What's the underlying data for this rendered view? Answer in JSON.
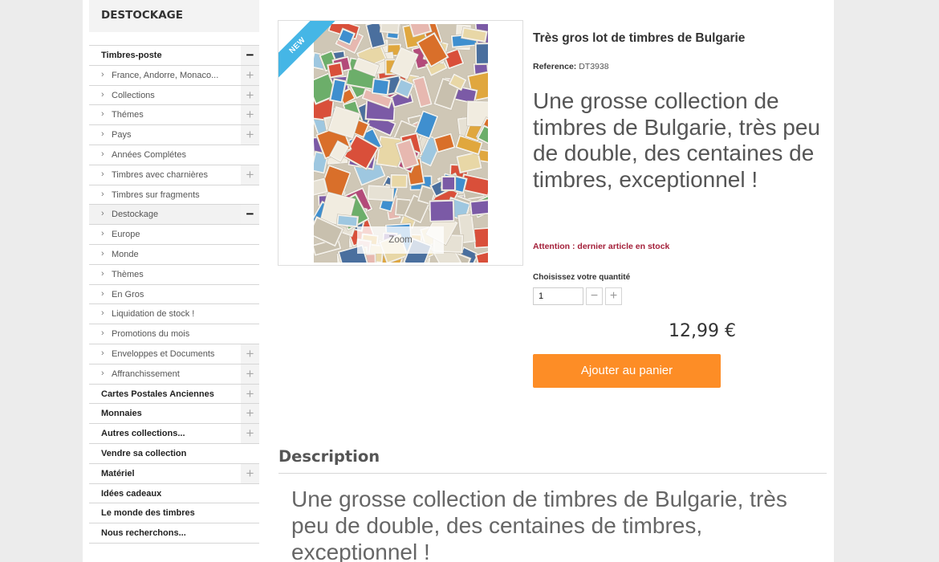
{
  "sidebar": {
    "heading": "DESTOCKAGE",
    "items": [
      {
        "label": "Timbres-poste",
        "level": 0,
        "toggle": "−"
      },
      {
        "label": "France, Andorre, Monaco...",
        "level": 1,
        "toggle": "+"
      },
      {
        "label": "Collections",
        "level": 1,
        "toggle": "+"
      },
      {
        "label": "Thémes",
        "level": 1,
        "toggle": "+"
      },
      {
        "label": "Pays",
        "level": 1,
        "toggle": "+"
      },
      {
        "label": "Années Complétes",
        "level": 1,
        "toggle": ""
      },
      {
        "label": "Timbres avec charnières",
        "level": 1,
        "toggle": "+"
      },
      {
        "label": "Timbres sur fragments",
        "level": 1,
        "toggle": ""
      },
      {
        "label": "Destockage",
        "level": 1,
        "toggle": "−",
        "highlight": true
      },
      {
        "label": "Europe",
        "level": 1,
        "toggle": ""
      },
      {
        "label": "Monde",
        "level": 1,
        "toggle": ""
      },
      {
        "label": "Thèmes",
        "level": 1,
        "toggle": ""
      },
      {
        "label": "En Gros",
        "level": 1,
        "toggle": ""
      },
      {
        "label": "Liquidation de stock !",
        "level": 1,
        "toggle": ""
      },
      {
        "label": "Promotions du mois",
        "level": 1,
        "toggle": ""
      },
      {
        "label": "Enveloppes et Documents",
        "level": 1,
        "toggle": "+"
      },
      {
        "label": "Affranchissement",
        "level": 1,
        "toggle": "+"
      },
      {
        "label": "Cartes Postales Anciennes",
        "level": 0,
        "toggle": "+"
      },
      {
        "label": "Monnaies",
        "level": 0,
        "toggle": "+"
      },
      {
        "label": "Autres collections...",
        "level": 0,
        "toggle": "+"
      },
      {
        "label": "Vendre sa collection",
        "level": 0,
        "toggle": ""
      },
      {
        "label": "Matériel",
        "level": 0,
        "toggle": "+"
      },
      {
        "label": "Idées cadeaux",
        "level": 0,
        "toggle": ""
      },
      {
        "label": "Le monde des timbres",
        "level": 0,
        "toggle": ""
      },
      {
        "label": "Nous recherchons...",
        "level": 0,
        "toggle": ""
      }
    ]
  },
  "product": {
    "badge": "NEW",
    "zoom_label": "Zoom",
    "title": "Très gros lot de timbres de Bulgarie",
    "reference_label": "Reference:",
    "reference_value": "DT3938",
    "short_description": "Une grosse collection de timbres de Bulgarie, très peu de double, des centaines de timbres, exceptionnel !",
    "stock_warning": "Attention : dernier article en stock",
    "quantity_label": "Choisissez votre quantité",
    "quantity_value": "1",
    "minus_label": "−",
    "plus_label": "+",
    "price": "12,99 €",
    "add_to_cart": "Ajouter au panier"
  },
  "description": {
    "heading": "Description",
    "body": "Une grosse collection de timbres de Bulgarie, très peu de double, des centaines de timbres, exceptionnel !"
  },
  "colors": {
    "accent_orange": "#fd8d26",
    "ribbon_blue": "#45b6e6",
    "warning_red": "#a4203a"
  }
}
